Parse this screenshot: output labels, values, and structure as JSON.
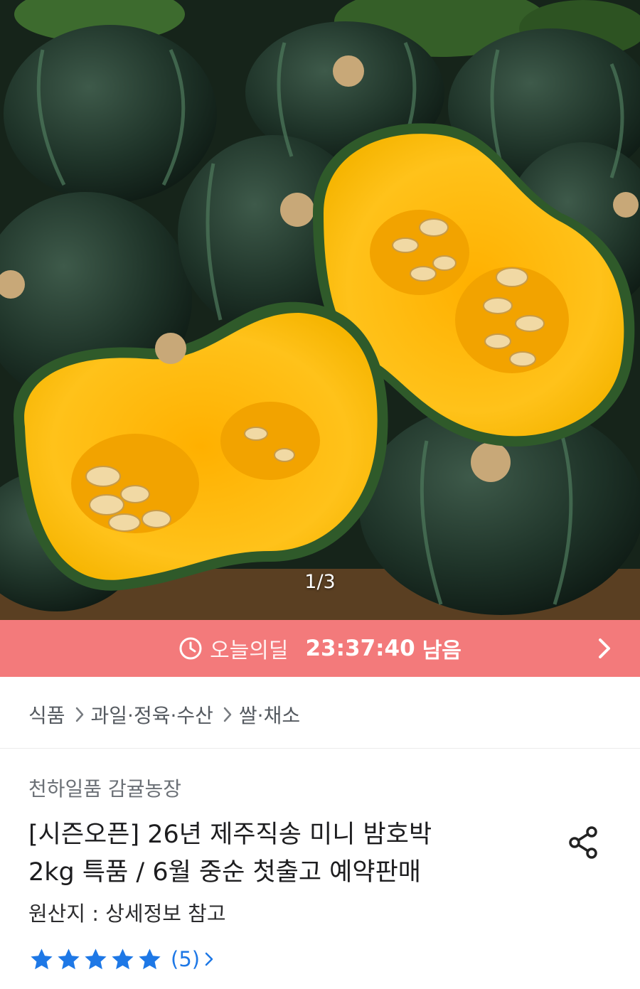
{
  "product": {
    "image_counter": "1/3",
    "image_description": "pumpkin-photo",
    "breadcrumb": [
      "식품",
      "과일·정육·수산",
      "쌀·채소"
    ],
    "seller": "천하일품 감귤농장",
    "title_line1": "[시즌오픈] 26년 제주직송 미니 밤호박",
    "title_line2": "2kg 특품 / 6월 중순 첫출고 예약판매",
    "origin": "원산지 : 상세정보 참고",
    "rating": {
      "stars": 5,
      "max_stars": 5,
      "review_count": "(5)"
    }
  },
  "deal": {
    "label": "오늘의딜",
    "timer": "23:37:40",
    "remaining_label": "남음"
  },
  "colors": {
    "deal_bar": "#f37a7b",
    "star": "#1e78e6",
    "review_link": "#1e78e6"
  },
  "icons": {
    "deal": "clock-icon",
    "deal_arrow": "chevron-right-icon",
    "breadcrumb_separator": "chevron-right-icon",
    "share": "share-icon",
    "star": "star-icon"
  }
}
